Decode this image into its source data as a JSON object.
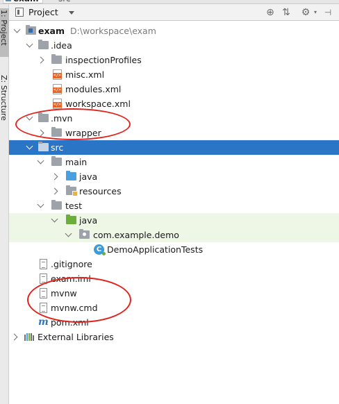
{
  "top_tabs": [
    "exam",
    "src"
  ],
  "side_tabs": {
    "project": "1: Project",
    "structure": "Z: Structure"
  },
  "header": {
    "title": "Project"
  },
  "tree": {
    "root": {
      "label": "exam",
      "path": "D:\\workspace\\exam"
    },
    "idea": "idea",
    "inspectionProfiles": "inspectionProfiles",
    "misc": "misc.xml",
    "modules": "modules.xml",
    "workspace": "workspace.xml",
    "mvn": ".mvn",
    "wrapper": "wrapper",
    "src": "src",
    "main": "main",
    "java_main": "java",
    "resources": "resources",
    "test": "test",
    "java_test": "java",
    "package": "com.example.demo",
    "test_class": "DemoApplicationTests",
    "gitignore": ".gitignore",
    "iml": "exam.iml",
    "mvnw": "mvnw",
    "mvnw_cmd": "mvnw.cmd",
    "pom": "pom.xml",
    "ext_libs": "External Libraries"
  },
  "colors": {
    "selection": "#2a75c6",
    "test_highlight": "#eef6e6",
    "annotation_ring": "#e3211b"
  }
}
